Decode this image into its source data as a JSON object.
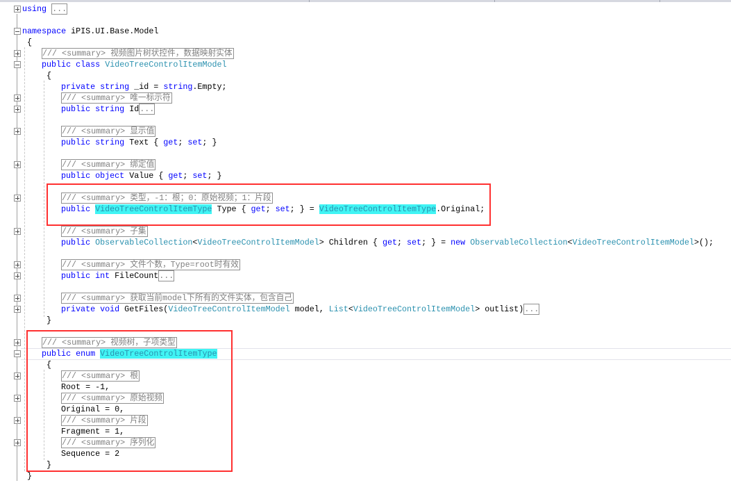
{
  "editor": {
    "colors": {
      "keyword": "#0000ff",
      "type": "#2b91af",
      "comment": "#808080",
      "highlight": "#40f4f4",
      "annotation": "#ff3030"
    },
    "lines": [
      {
        "indent": 0,
        "exp": "plus",
        "tokens": [
          [
            "k",
            "using"
          ],
          [
            "p",
            " "
          ],
          [
            "e",
            "..."
          ]
        ]
      },
      {
        "indent": 0,
        "tokens": []
      },
      {
        "indent": 0,
        "exp": "minus",
        "tokens": [
          [
            "k",
            "namespace"
          ],
          [
            "p",
            " iPIS.UI.Base.Model"
          ]
        ]
      },
      {
        "indent": 0,
        "tokens": [
          [
            "p",
            " {"
          ]
        ]
      },
      {
        "indent": 1,
        "exp": "plus",
        "tokens": [
          [
            "c",
            "/// <summary> 视频图片树状控件，数据映射实体"
          ]
        ]
      },
      {
        "indent": 1,
        "exp": "minus",
        "tokens": [
          [
            "k",
            "public class"
          ],
          [
            "p",
            " "
          ],
          [
            "t",
            "VideoTreeControlItemModel"
          ]
        ]
      },
      {
        "indent": 1,
        "tokens": [
          [
            "p",
            " {"
          ]
        ]
      },
      {
        "indent": 2,
        "tokens": [
          [
            "k",
            "private string"
          ],
          [
            "p",
            " _id = "
          ],
          [
            "k",
            "string"
          ],
          [
            "p",
            ".Empty;"
          ]
        ]
      },
      {
        "indent": 2,
        "exp": "plus",
        "tokens": [
          [
            "c",
            "/// <summary> 唯一标示符"
          ]
        ]
      },
      {
        "indent": 2,
        "exp": "plus",
        "tokens": [
          [
            "k",
            "public string"
          ],
          [
            "p",
            " Id"
          ],
          [
            "e",
            "..."
          ]
        ]
      },
      {
        "indent": 2,
        "tokens": []
      },
      {
        "indent": 2,
        "exp": "plus",
        "tokens": [
          [
            "c",
            "/// <summary> 显示值"
          ]
        ]
      },
      {
        "indent": 2,
        "tokens": [
          [
            "k",
            "public string"
          ],
          [
            "p",
            " Text { "
          ],
          [
            "k",
            "get"
          ],
          [
            "p",
            "; "
          ],
          [
            "k",
            "set"
          ],
          [
            "p",
            "; }"
          ]
        ]
      },
      {
        "indent": 2,
        "tokens": []
      },
      {
        "indent": 2,
        "exp": "plus",
        "tokens": [
          [
            "c",
            "/// <summary> 绑定值"
          ]
        ]
      },
      {
        "indent": 2,
        "tokens": [
          [
            "k",
            "public object"
          ],
          [
            "p",
            " Value { "
          ],
          [
            "k",
            "get"
          ],
          [
            "p",
            "; "
          ],
          [
            "k",
            "set"
          ],
          [
            "p",
            "; }"
          ]
        ]
      },
      {
        "indent": 2,
        "tokens": []
      },
      {
        "indent": 2,
        "exp": "plus",
        "tokens": [
          [
            "c",
            "/// <summary> 类型，-1：根；0：原始视频；1：片段"
          ]
        ]
      },
      {
        "indent": 2,
        "tokens": [
          [
            "k",
            "public"
          ],
          [
            "p",
            " "
          ],
          [
            "h",
            "VideoTreeControlItemType"
          ],
          [
            "p",
            " Type { "
          ],
          [
            "k",
            "get"
          ],
          [
            "p",
            "; "
          ],
          [
            "k",
            "set"
          ],
          [
            "p",
            "; } = "
          ],
          [
            "h",
            "VideoTreeControlItemType"
          ],
          [
            "p",
            ".Original;"
          ]
        ]
      },
      {
        "indent": 2,
        "tokens": []
      },
      {
        "indent": 2,
        "exp": "plus",
        "tokens": [
          [
            "c",
            "/// <summary> 子集"
          ]
        ]
      },
      {
        "indent": 2,
        "tokens": [
          [
            "k",
            "public"
          ],
          [
            "p",
            " "
          ],
          [
            "t",
            "ObservableCollection"
          ],
          [
            "p",
            "<"
          ],
          [
            "t",
            "VideoTreeControlItemModel"
          ],
          [
            "p",
            "> Children { "
          ],
          [
            "k",
            "get"
          ],
          [
            "p",
            "; "
          ],
          [
            "k",
            "set"
          ],
          [
            "p",
            "; } = "
          ],
          [
            "k",
            "new"
          ],
          [
            "p",
            " "
          ],
          [
            "t",
            "ObservableCollection"
          ],
          [
            "p",
            "<"
          ],
          [
            "t",
            "VideoTreeControlItemModel"
          ],
          [
            "p",
            ">();"
          ]
        ]
      },
      {
        "indent": 2,
        "tokens": []
      },
      {
        "indent": 2,
        "exp": "plus",
        "tokens": [
          [
            "c",
            "/// <summary> 文件个数，Type=root时有效"
          ]
        ]
      },
      {
        "indent": 2,
        "exp": "plus",
        "tokens": [
          [
            "k",
            "public int"
          ],
          [
            "p",
            " FileCount"
          ],
          [
            "e",
            "..."
          ]
        ]
      },
      {
        "indent": 2,
        "tokens": []
      },
      {
        "indent": 2,
        "exp": "plus",
        "tokens": [
          [
            "c",
            "/// <summary> 获取当前model下所有的文件实体，包含自己"
          ]
        ]
      },
      {
        "indent": 2,
        "exp": "plus",
        "tokens": [
          [
            "k",
            "private void"
          ],
          [
            "p",
            " GetFiles("
          ],
          [
            "t",
            "VideoTreeControlItemModel"
          ],
          [
            "p",
            " model, "
          ],
          [
            "t",
            "List"
          ],
          [
            "p",
            "<"
          ],
          [
            "t",
            "VideoTreeControlItemModel"
          ],
          [
            "p",
            "> outlist)"
          ],
          [
            "e",
            "..."
          ]
        ]
      },
      {
        "indent": 1,
        "tokens": [
          [
            "p",
            " }"
          ]
        ]
      },
      {
        "indent": 1,
        "tokens": []
      },
      {
        "indent": 1,
        "exp": "plus",
        "tokens": [
          [
            "c",
            "/// <summary> 视频树，子项类型"
          ]
        ]
      },
      {
        "indent": 1,
        "exp": "minus",
        "tokens": [
          [
            "k",
            "public enum"
          ],
          [
            "p",
            " "
          ],
          [
            "h",
            "VideoTreeControlItemType"
          ]
        ]
      },
      {
        "indent": 1,
        "tokens": [
          [
            "p",
            " {"
          ]
        ]
      },
      {
        "indent": 2,
        "exp": "plus",
        "tokens": [
          [
            "c",
            "/// <summary> 根"
          ]
        ]
      },
      {
        "indent": 2,
        "tokens": [
          [
            "p",
            "Root = -1,"
          ]
        ]
      },
      {
        "indent": 2,
        "exp": "plus",
        "tokens": [
          [
            "c",
            "/// <summary> 原始视频"
          ]
        ]
      },
      {
        "indent": 2,
        "tokens": [
          [
            "p",
            "Original = 0,"
          ]
        ]
      },
      {
        "indent": 2,
        "exp": "plus",
        "tokens": [
          [
            "c",
            "/// <summary> 片段"
          ]
        ]
      },
      {
        "indent": 2,
        "tokens": [
          [
            "p",
            "Fragment = 1,"
          ]
        ]
      },
      {
        "indent": 2,
        "exp": "plus",
        "tokens": [
          [
            "c",
            "/// <summary> 序列化"
          ]
        ]
      },
      {
        "indent": 2,
        "tokens": [
          [
            "p",
            "Sequence = 2"
          ]
        ]
      },
      {
        "indent": 1,
        "tokens": [
          [
            "p",
            " }"
          ]
        ]
      },
      {
        "indent": 0,
        "tokens": [
          [
            "p",
            " }"
          ]
        ]
      }
    ]
  }
}
